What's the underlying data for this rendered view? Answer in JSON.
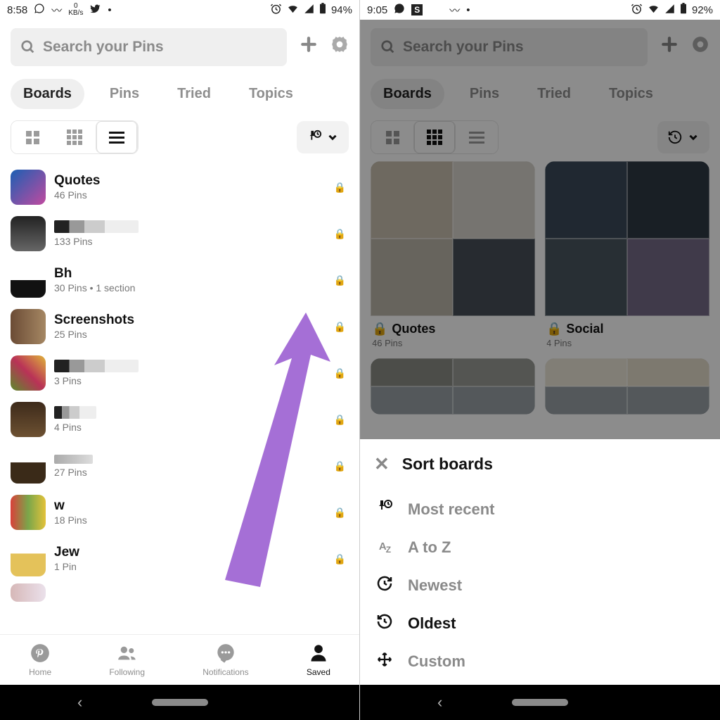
{
  "left": {
    "status": {
      "time": "8:58",
      "battery": "94%"
    },
    "search": {
      "placeholder": "Search your Pins"
    },
    "tabs": [
      "Boards",
      "Pins",
      "Tried",
      "Topics"
    ],
    "active_tab": 0,
    "view_active": 2,
    "boards": [
      {
        "title": "Quotes",
        "sub": "46 Pins",
        "blur": false
      },
      {
        "title": "",
        "sub": "133 Pins",
        "blur": true
      },
      {
        "title": "Bh",
        "sub": "30 Pins • 1 section",
        "blur": false
      },
      {
        "title": "Screenshots",
        "sub": "25 Pins",
        "blur": false
      },
      {
        "title": "",
        "sub": "3 Pins",
        "blur": true
      },
      {
        "title": "",
        "sub": "4 Pins",
        "blur": true
      },
      {
        "title": "",
        "sub": "27 Pins",
        "blur": true
      },
      {
        "title": "w",
        "sub": "18 Pins",
        "blur": false
      },
      {
        "title": "Jew",
        "sub": "1 Pin",
        "blur": false
      }
    ],
    "nav": [
      {
        "label": "Home"
      },
      {
        "label": "Following"
      },
      {
        "label": "Notifications"
      },
      {
        "label": "Saved"
      }
    ],
    "nav_active": 3
  },
  "right": {
    "status": {
      "time": "9:05",
      "battery": "92%"
    },
    "search": {
      "placeholder": "Search your Pins"
    },
    "tabs": [
      "Boards",
      "Pins",
      "Tried",
      "Topics"
    ],
    "cards": [
      {
        "title": "Quotes",
        "sub": "46 Pins"
      },
      {
        "title": "Social",
        "sub": "4 Pins"
      }
    ],
    "sheet": {
      "title": "Sort boards",
      "items": [
        "Most recent",
        "A to Z",
        "Newest",
        "Oldest",
        "Custom"
      ],
      "active": 3
    }
  }
}
